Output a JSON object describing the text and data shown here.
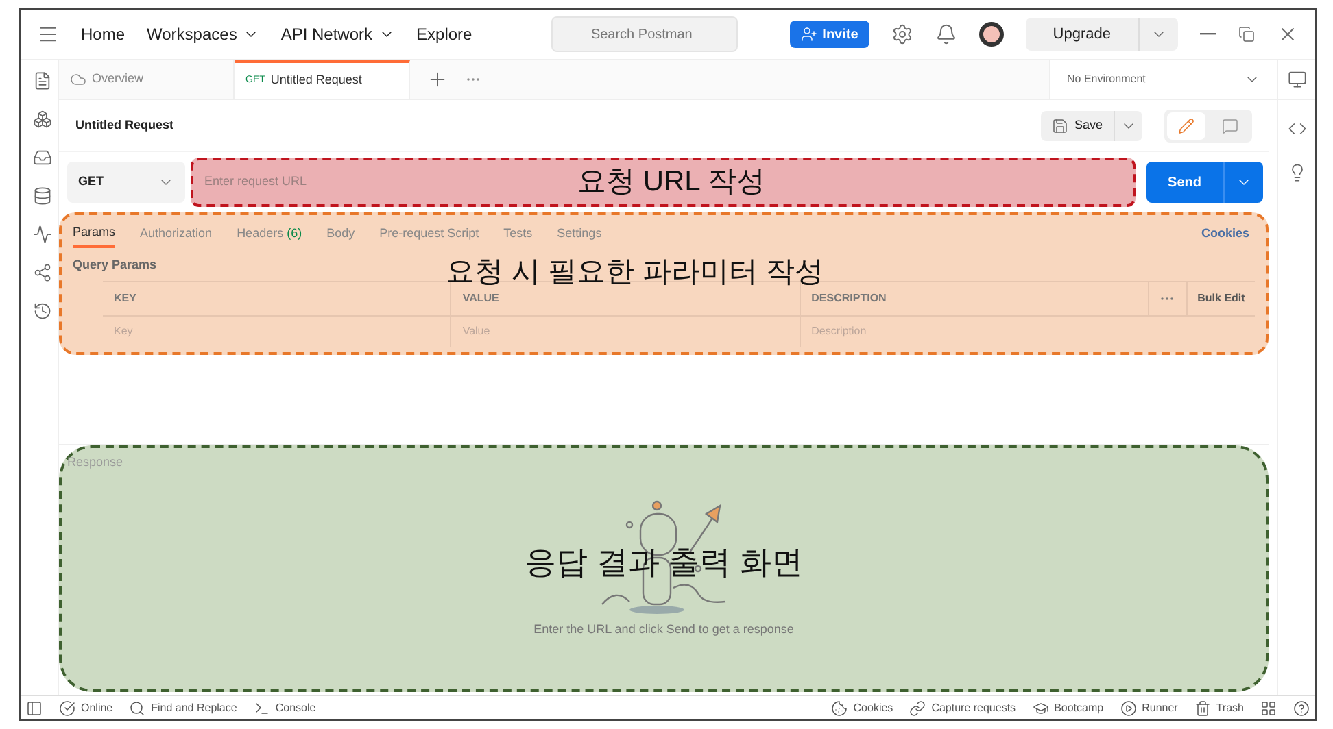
{
  "nav": {
    "links": [
      {
        "label": "Home",
        "dropdown": false
      },
      {
        "label": "Workspaces",
        "dropdown": true
      },
      {
        "label": "API Network",
        "dropdown": true
      },
      {
        "label": "Explore",
        "dropdown": false
      }
    ],
    "search": {
      "placeholder": "Search Postman"
    },
    "invite": "Invite",
    "upgrade": "Upgrade"
  },
  "tabs": [
    {
      "label": "Overview",
      "selected": false
    },
    {
      "label": "Untitled Request",
      "method": "GET",
      "selected": true
    }
  ],
  "environment": "No Environment",
  "request": {
    "title": "Untitled Request",
    "save": "Save",
    "method": "GET",
    "url_placeholder": "Enter request URL",
    "send": "Send"
  },
  "request_tabs": [
    {
      "label": "Params",
      "selected": true
    },
    {
      "label": "Authorization",
      "selected": false
    },
    {
      "label": "Headers",
      "count": "(6)",
      "selected": false
    },
    {
      "label": "Body",
      "selected": false
    },
    {
      "label": "Pre-request Script",
      "selected": false
    },
    {
      "label": "Tests",
      "selected": false
    },
    {
      "label": "Settings",
      "selected": false
    }
  ],
  "cookies_link": "Cookies",
  "query_params": {
    "title": "Query Params",
    "columns": [
      "KEY",
      "VALUE",
      "DESCRIPTION"
    ],
    "bulk_edit": "Bulk Edit",
    "placeholders": [
      "Key",
      "Value",
      "Description"
    ]
  },
  "response": {
    "title": "Response",
    "hint": "Enter the URL and click Send to get a response"
  },
  "annotations": [
    {
      "text": "요청 URL 작성",
      "color": "#c0141e"
    },
    {
      "text": "요청 시 필요한 파라미터 작성",
      "color": "#e8782a"
    },
    {
      "text": "응답 결과 출력 화면",
      "color": "#3f6130"
    }
  ],
  "status_bar": {
    "left": [
      "Online",
      "Find and Replace",
      "Console"
    ],
    "right": [
      "Cookies",
      "Capture requests",
      "Bootcamp",
      "Runner",
      "Trash"
    ]
  }
}
